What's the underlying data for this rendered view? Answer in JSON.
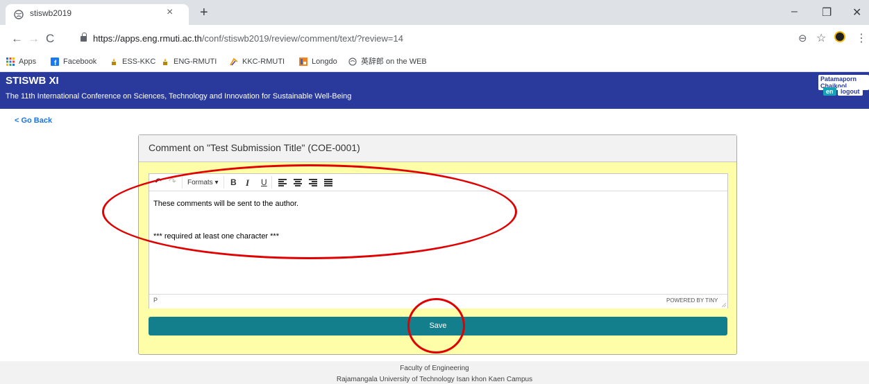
{
  "browser": {
    "tab_title": "stiswb2019",
    "tab_close": "×",
    "new_tab": "+",
    "window_controls": {
      "minimize": "–",
      "maximize": "❐",
      "close": "✕"
    },
    "nav": {
      "back": "←",
      "forward": "→",
      "reload": "C"
    },
    "url": {
      "host": "https://apps.eng.rmuti.ac.th",
      "path": "/conf/stiswb2019/review/comment/text/?review=14"
    },
    "zoom_glyph": "⊖",
    "star_glyph": "☆",
    "menu_glyph": "⋮",
    "bookmarks": [
      {
        "label": "Apps",
        "icon": "apps-grid-icon"
      },
      {
        "label": "Facebook",
        "icon": "facebook-icon"
      },
      {
        "label": "ESS-KKC",
        "icon": "candle-icon"
      },
      {
        "label": "ENG-RMUTI",
        "icon": "candle-icon"
      },
      {
        "label": "KKC-RMUTI",
        "icon": "kkc-icon"
      },
      {
        "label": "Longdo",
        "icon": "longdo-icon"
      },
      {
        "label": "英辞郎 on the WEB",
        "icon": "eijiro-icon"
      }
    ]
  },
  "site": {
    "title": "STISWB XI",
    "subtitle": "The 11th International Conference on Sciences, Technology and Innovation for Sustainable Well-Being",
    "user_name": "Patamaporn Chaikool",
    "lang": "en",
    "logout": "logout",
    "go_back": "< Go Back"
  },
  "card": {
    "title": "Comment on \"Test Submission Title\" (COE-0001)"
  },
  "editor": {
    "toolbar": {
      "undo": "↶",
      "redo": "↷",
      "formats": "Formats ▾",
      "bold": "B",
      "italic": "I",
      "underline": "U"
    },
    "content_line1": "These comments will be sent to the author.",
    "content_line2": "*** required at least one character ***",
    "status_path": "P",
    "powered_by": "POWERED BY TINY"
  },
  "save_label": "Save",
  "footer": {
    "line1": "Faculty of Engineering",
    "line2": "Rajamangala University of Technology Isan khon Kaen Campus"
  },
  "colors": {
    "header_bg": "#293a9c",
    "card_bg": "#fffea8",
    "save_bg": "#137f8c",
    "annotation": "#e00000"
  }
}
